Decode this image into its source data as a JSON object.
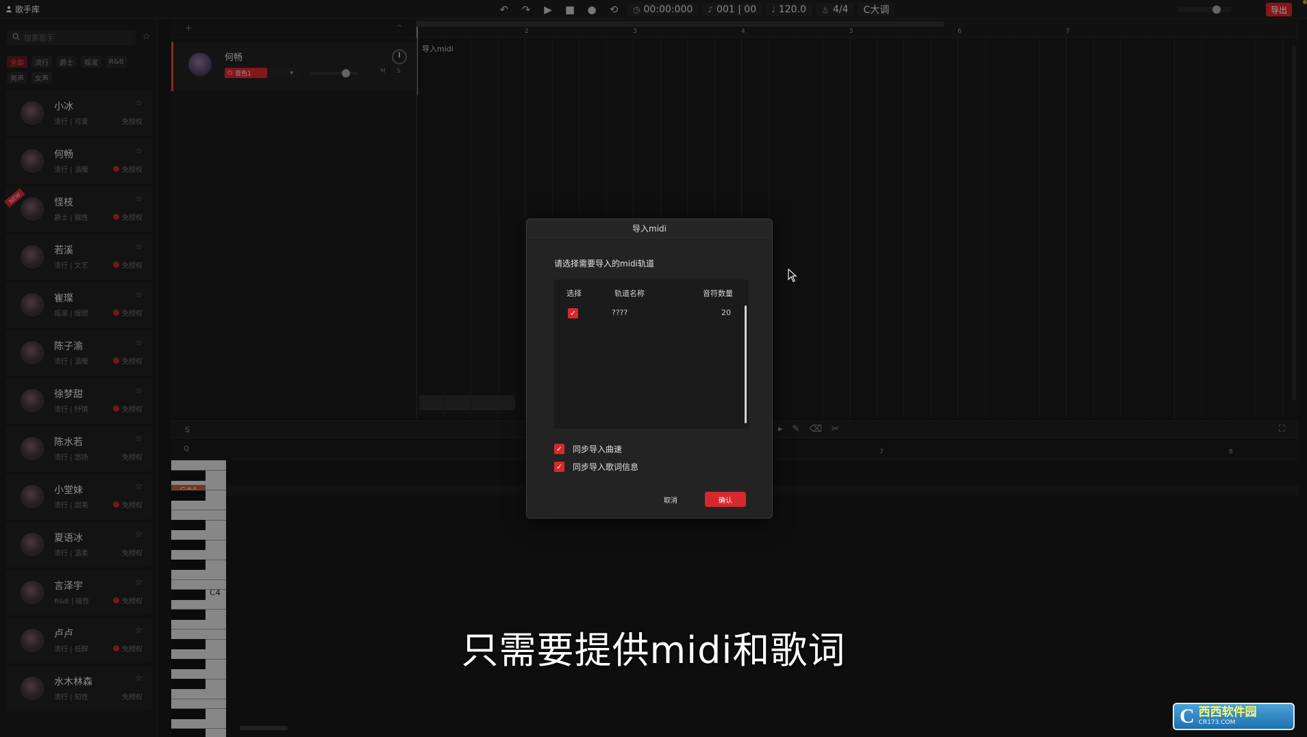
{
  "topbar": {
    "library_label": "歌手库",
    "time": "00:00:000",
    "position": "001 | 00",
    "tempo": "120.0",
    "time_signature": "4/4",
    "key": "C大调",
    "export_label": "导出"
  },
  "sidebar": {
    "search_placeholder": "搜索歌手",
    "filters": [
      "全部",
      "流行",
      "爵士",
      "摇滚",
      "R&B",
      "男声",
      "女声"
    ],
    "active_filter": "全部",
    "singers": [
      {
        "name": "小冰",
        "tags": "流行 | 可爱",
        "license": "免授权",
        "lic_dot": false,
        "is_new": false
      },
      {
        "name": "何畅",
        "tags": "流行 | 温暖",
        "license": "免授权",
        "lic_dot": true,
        "is_new": false
      },
      {
        "name": "怪枝",
        "tags": "爵士 | 磁性",
        "license": "免授权",
        "lic_dot": true,
        "is_new": true
      },
      {
        "name": "若溪",
        "tags": "流行 | 文艺",
        "license": "免授权",
        "lic_dot": true,
        "is_new": false
      },
      {
        "name": "崔璨",
        "tags": "摇滚 | 爆燃",
        "license": "免授权",
        "lic_dot": true,
        "is_new": false
      },
      {
        "name": "陈子渝",
        "tags": "流行 | 温暖",
        "license": "免授权",
        "lic_dot": true,
        "is_new": false
      },
      {
        "name": "徐梦甜",
        "tags": "流行 | 抒情",
        "license": "免授权",
        "lic_dot": true,
        "is_new": false
      },
      {
        "name": "陈水若",
        "tags": "流行 | 悠扬",
        "license": "免授权",
        "lic_dot": false,
        "is_new": false
      },
      {
        "name": "小堂妹",
        "tags": "流行 | 甜美",
        "license": "免授权",
        "lic_dot": true,
        "is_new": false
      },
      {
        "name": "夏语冰",
        "tags": "流行 | 温柔",
        "license": "免授权",
        "lic_dot": false,
        "is_new": false
      },
      {
        "name": "言泽宇",
        "tags": "R&B | 磁性",
        "license": "免授权",
        "lic_dot": true,
        "is_new": false
      },
      {
        "name": "卢卢",
        "tags": "流行 | 低醇",
        "license": "免授权",
        "lic_dot": true,
        "is_new": false
      },
      {
        "name": "水木林森",
        "tags": "流行 | 知性",
        "license": "免授权",
        "lic_dot": false,
        "is_new": false
      }
    ],
    "new_badge": "NEW"
  },
  "track": {
    "singer_name": "何畅",
    "preset_label": "音色1",
    "mute_label": "M",
    "solo_label": "S"
  },
  "arrange": {
    "clip_label": "导入midi",
    "ruler_numbers": [
      "2",
      "3",
      "4",
      "5",
      "6",
      "7"
    ]
  },
  "editor": {
    "s_label": "S",
    "q_label": "Q",
    "ruler_numbers": [
      "7",
      "8"
    ],
    "highlight_key": "G#4",
    "c_label": "C4"
  },
  "modal": {
    "title": "导入midi",
    "prompt": "请选择需要导入的midi轨道",
    "columns": [
      "选择",
      "轨道名称",
      "音符数量"
    ],
    "rows": [
      {
        "checked": true,
        "name": "????",
        "notes": "20"
      }
    ],
    "option_tempo": "同步导入曲速",
    "option_lyrics": "同步导入歌词信息",
    "cancel": "取消",
    "confirm": "确认"
  },
  "caption": "只需要提供midi和歌词",
  "watermark": {
    "letter": "C",
    "title": "西西软件园",
    "url": "CR173.COM"
  },
  "colors": {
    "accent": "#d7282e",
    "background": "#161616",
    "panel": "#232323"
  }
}
